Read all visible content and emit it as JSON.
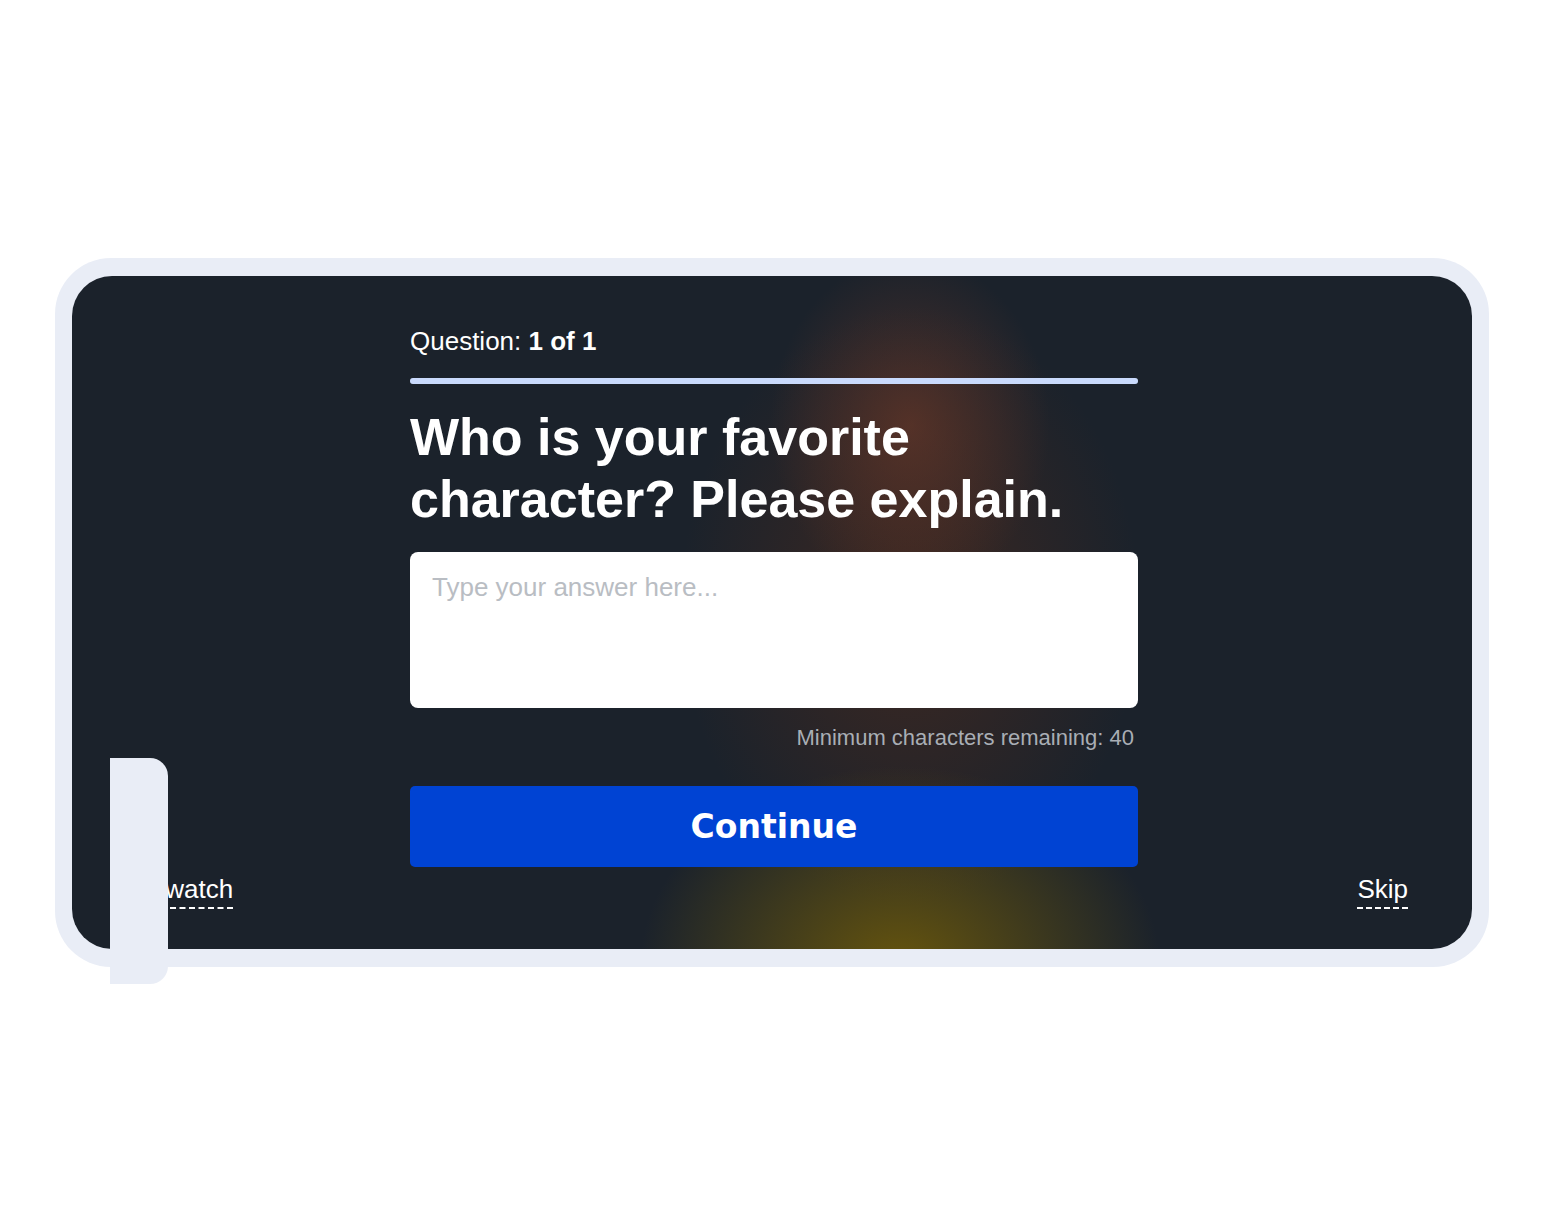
{
  "question": {
    "label": "Question:",
    "count": "1 of 1"
  },
  "progress": {
    "level": 1
  },
  "title": "Who is your favorite character? Please explain.",
  "answer": {
    "placeholder": "Type your answer here..."
  },
  "counter": "Minimum characters remaining: 40",
  "continue_button": "Continue",
  "footer": {
    "rewatch": "Rewatch",
    "skip": "Skip"
  }
}
